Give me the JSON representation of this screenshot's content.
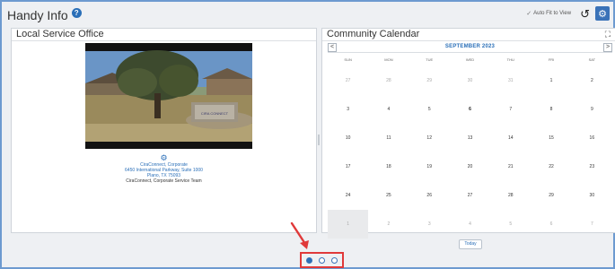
{
  "header": {
    "title": "Handy Info",
    "auto_fit_label": "Auto Fit to View"
  },
  "icons": {
    "help": "?",
    "check": "✓",
    "refresh": "↺",
    "settings": "⚙",
    "expand": "⛶",
    "gear": "⚙",
    "prev": "<",
    "next": ">"
  },
  "office": {
    "panel_title": "Local Service Office",
    "name": "CiraConnect, Corporate",
    "address_line1": "6450 International Parkway, Suite 1000",
    "address_line2": "Plano, TX 75093",
    "team": "CiraConnect, Corporate Service Team",
    "sign_text": "CIRA CONNECT"
  },
  "calendar": {
    "panel_title": "Community Calendar",
    "month": "SEPTEMBER 2023",
    "weekdays": [
      "SUN",
      "MON",
      "TUE",
      "WED",
      "THU",
      "FRI",
      "SAT"
    ],
    "weeks": [
      [
        {
          "d": "27",
          "m": true
        },
        {
          "d": "28",
          "m": true
        },
        {
          "d": "29",
          "m": true
        },
        {
          "d": "30",
          "m": true
        },
        {
          "d": "31",
          "m": true
        },
        {
          "d": "1"
        },
        {
          "d": "2"
        }
      ],
      [
        {
          "d": "3"
        },
        {
          "d": "4"
        },
        {
          "d": "5"
        },
        {
          "d": "6",
          "b": true
        },
        {
          "d": "7"
        },
        {
          "d": "8"
        },
        {
          "d": "9"
        }
      ],
      [
        {
          "d": "10"
        },
        {
          "d": "11"
        },
        {
          "d": "12"
        },
        {
          "d": "13"
        },
        {
          "d": "14"
        },
        {
          "d": "15"
        },
        {
          "d": "16"
        }
      ],
      [
        {
          "d": "17"
        },
        {
          "d": "18"
        },
        {
          "d": "19"
        },
        {
          "d": "20"
        },
        {
          "d": "21"
        },
        {
          "d": "22"
        },
        {
          "d": "23"
        }
      ],
      [
        {
          "d": "24"
        },
        {
          "d": "25"
        },
        {
          "d": "26"
        },
        {
          "d": "27"
        },
        {
          "d": "28"
        },
        {
          "d": "29"
        },
        {
          "d": "30"
        }
      ],
      [
        {
          "d": "1",
          "m": true,
          "s": true
        },
        {
          "d": "2",
          "m": true
        },
        {
          "d": "3",
          "m": true
        },
        {
          "d": "4",
          "m": true
        },
        {
          "d": "5",
          "m": true
        },
        {
          "d": "6",
          "m": true
        },
        {
          "d": "7",
          "m": true
        }
      ]
    ],
    "today_label": "Today"
  },
  "pager": {
    "pages": 3,
    "active": 0
  },
  "colors": {
    "accent": "#2a6fb8",
    "frame": "#6d9ad0",
    "highlight": "#e0393a"
  }
}
